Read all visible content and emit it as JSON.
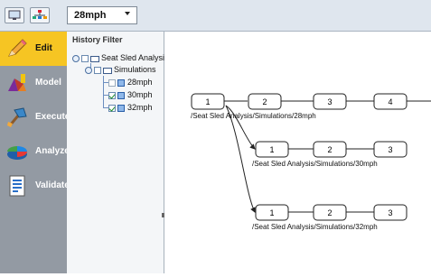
{
  "toolbar": {
    "speed_value": "28mph"
  },
  "nav": {
    "items": [
      {
        "label": "Edit",
        "icon": "pencil-icon",
        "active": true
      },
      {
        "label": "Model",
        "icon": "model-icon"
      },
      {
        "label": "Execute",
        "icon": "hammer-icon"
      },
      {
        "label": "Analyze",
        "icon": "pie-chart-icon"
      },
      {
        "label": "Validate",
        "icon": "document-icon"
      }
    ]
  },
  "history": {
    "title": "History Filter",
    "root": "Seat Sled Analysis",
    "group": "Simulations",
    "runs": [
      "28mph",
      "30mph",
      "32mph"
    ]
  },
  "graph": {
    "rows": [
      {
        "nodes": [
          "1",
          "2",
          "3",
          "4"
        ],
        "path": "/Seat Sled Analysis/Simulations/28mph"
      },
      {
        "nodes": [
          "1",
          "2",
          "3"
        ],
        "path": "/Seat Sled Analysis/Simulations/30mph"
      },
      {
        "nodes": [
          "1",
          "2",
          "3"
        ],
        "path": "/Seat Sled Analysis/Simulations/32mph"
      }
    ]
  },
  "colors": {
    "accent": "#f6c523",
    "nav_bg": "#939aa3",
    "toolbar_bg": "#dfe6ee"
  }
}
